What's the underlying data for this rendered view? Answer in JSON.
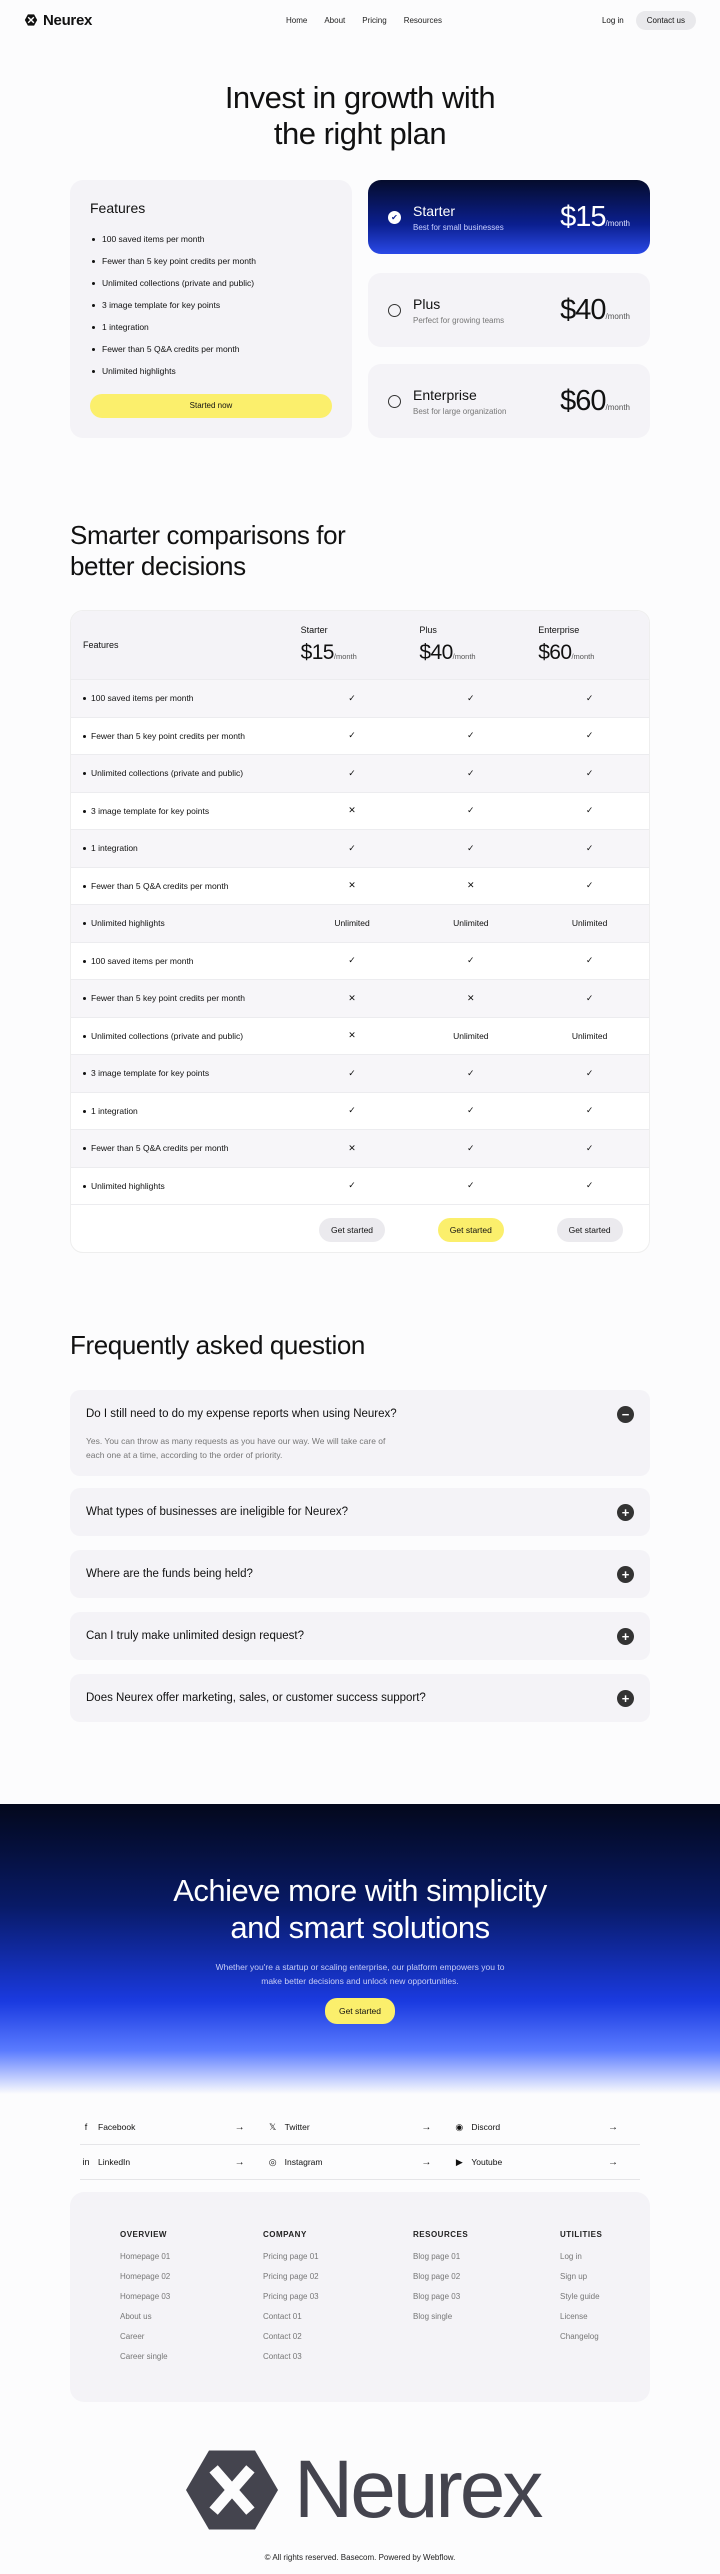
{
  "nav": {
    "brand": "Neurex",
    "links": [
      "Home",
      "About",
      "Pricing",
      "Resources"
    ],
    "login": "Log in",
    "contact": "Contact us"
  },
  "hero": {
    "title_line1": "Invest in growth with",
    "title_line2": "the right plan"
  },
  "features": {
    "title": "Features",
    "items": [
      "100 saved items per month",
      "Fewer than 5 key point credits per month",
      "Unlimited collections (private and public)",
      "3 image template for key points",
      "1 integration",
      "Fewer than 5 Q&A credits per month",
      "Unlimited highlights"
    ],
    "button": "Started now"
  },
  "plans": [
    {
      "name": "Starter",
      "desc": "Best for small businesses",
      "price": "$15",
      "per": "/month",
      "selected": true
    },
    {
      "name": "Plus",
      "desc": "Perfect for growing teams",
      "price": "$40",
      "per": "/month",
      "selected": false
    },
    {
      "name": "Enterprise",
      "desc": "Best for large organization",
      "price": "$60",
      "per": "/month",
      "selected": false
    }
  ],
  "comparison": {
    "title_line1": "Smarter comparisons for",
    "title_line2": "better decisions",
    "features_header": "Features",
    "columns": [
      {
        "name": "Starter",
        "price": "$15",
        "per": "/month"
      },
      {
        "name": "Plus",
        "price": "$40",
        "per": "/month"
      },
      {
        "name": "Enterprise",
        "price": "$60",
        "per": "/month"
      }
    ],
    "rows": [
      {
        "feature": "100 saved items per month",
        "values": [
          "✓",
          "✓",
          "✓"
        ]
      },
      {
        "feature": "Fewer than 5 key point credits per month",
        "values": [
          "✓",
          "✓",
          "✓"
        ]
      },
      {
        "feature": "Unlimited collections (private and public)",
        "values": [
          "✓",
          "✓",
          "✓"
        ]
      },
      {
        "feature": "3 image template for key points",
        "values": [
          "✕",
          "✓",
          "✓"
        ]
      },
      {
        "feature": "1 integration",
        "values": [
          "✓",
          "✓",
          "✓"
        ]
      },
      {
        "feature": "Fewer than 5 Q&A credits per month",
        "values": [
          "✕",
          "✕",
          "✓"
        ]
      },
      {
        "feature": "Unlimited highlights",
        "values": [
          "Unlimited",
          "Unlimited",
          "Unlimited"
        ]
      },
      {
        "feature": "100 saved items per month",
        "values": [
          "✓",
          "✓",
          "✓"
        ]
      },
      {
        "feature": "Fewer than 5 key point credits per month",
        "values": [
          "✕",
          "✕",
          "✓"
        ]
      },
      {
        "feature": "Unlimited collections (private and public)",
        "values": [
          "✕",
          "Unlimited",
          "Unlimited"
        ]
      },
      {
        "feature": "3 image template for key points",
        "values": [
          "✓",
          "✓",
          "✓"
        ]
      },
      {
        "feature": "1 integration",
        "values": [
          "✓",
          "✓",
          "✓"
        ]
      },
      {
        "feature": "Fewer than 5 Q&A credits per month",
        "values": [
          "✕",
          "✓",
          "✓"
        ]
      },
      {
        "feature": "Unlimited highlights",
        "values": [
          "✓",
          "✓",
          "✓"
        ]
      }
    ],
    "button": "Get started"
  },
  "faq": {
    "title": "Frequently asked question",
    "items": [
      {
        "q": "Do I still need to do my expense reports when using Neurex?",
        "a": "Yes. You can throw as many requests as you have our way. We will take care of each one at a time, according to the order of priority.",
        "open": true
      },
      {
        "q": "What types of businesses are ineligible for Neurex?",
        "open": false
      },
      {
        "q": "Where are the funds being held?",
        "open": false
      },
      {
        "q": "Can I truly make unlimited design request?",
        "open": false
      },
      {
        "q": "Does Neurex offer marketing, sales, or customer success support?",
        "open": false
      }
    ]
  },
  "cta": {
    "title_line1": "Achieve more with simplicity",
    "title_line2": "and smart solutions",
    "text": "Whether you're a startup or scaling enterprise, our platform empowers you to make better decisions and unlock new opportunities.",
    "button": "Get started"
  },
  "social": [
    {
      "name": "Facebook",
      "icon": "facebook-icon"
    },
    {
      "name": "Twitter",
      "icon": "x-twitter-icon"
    },
    {
      "name": "Discord",
      "icon": "discord-icon"
    },
    {
      "name": "LinkedIn",
      "icon": "linkedin-icon"
    },
    {
      "name": "Instagram",
      "icon": "instagram-icon"
    },
    {
      "name": "Youtube",
      "icon": "youtube-icon"
    }
  ],
  "footer": {
    "columns": [
      {
        "title": "OVERVIEW",
        "links": [
          "Homepage 01",
          "Homepage 02",
          "Homepage 03",
          "About us",
          "Career",
          "Career single"
        ]
      },
      {
        "title": "COMPANY",
        "links": [
          "Pricing  page 01",
          "Pricing  page 02",
          "Pricing page 03",
          "Contact 01",
          "Contact 02",
          "Contact 03"
        ]
      },
      {
        "title": "RESOURCES",
        "links": [
          "Blog page 01",
          "Blog page 02",
          "Blog page 03",
          "Blog single"
        ]
      },
      {
        "title": "UTILITIES",
        "links": [
          "Log in",
          "Sign up",
          "Style guide",
          "License",
          "Changelog"
        ]
      }
    ],
    "brand": "Neurex",
    "copyright": "© All rights reserved. Basecom. Powered by Webflow."
  }
}
